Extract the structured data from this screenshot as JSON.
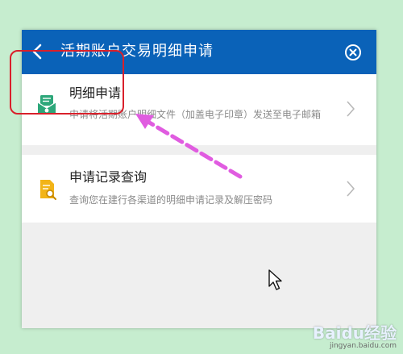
{
  "header": {
    "title": "活期账户交易明细申请",
    "back_icon": "chevron-left-icon",
    "close_icon": "close-circle-icon",
    "color": "#0a62b8"
  },
  "items": [
    {
      "title": "明细申请",
      "description": "申请将活期账户明细文件（加盖电子印章）发送至电子邮箱",
      "icon": "envelope-document-icon",
      "icon_color": "#2da77a"
    },
    {
      "title": "申请记录查询",
      "description": "查询您在建行各渠道的明细申请记录及解压密码",
      "icon": "document-search-icon",
      "icon_color": "#f2b417"
    }
  ],
  "annotations": {
    "highlight_color": "#d9202b",
    "arrow_color": "#e05ce0"
  },
  "watermark": {
    "brand": "Baidu经验",
    "url": "jingyan.baidu.com"
  }
}
